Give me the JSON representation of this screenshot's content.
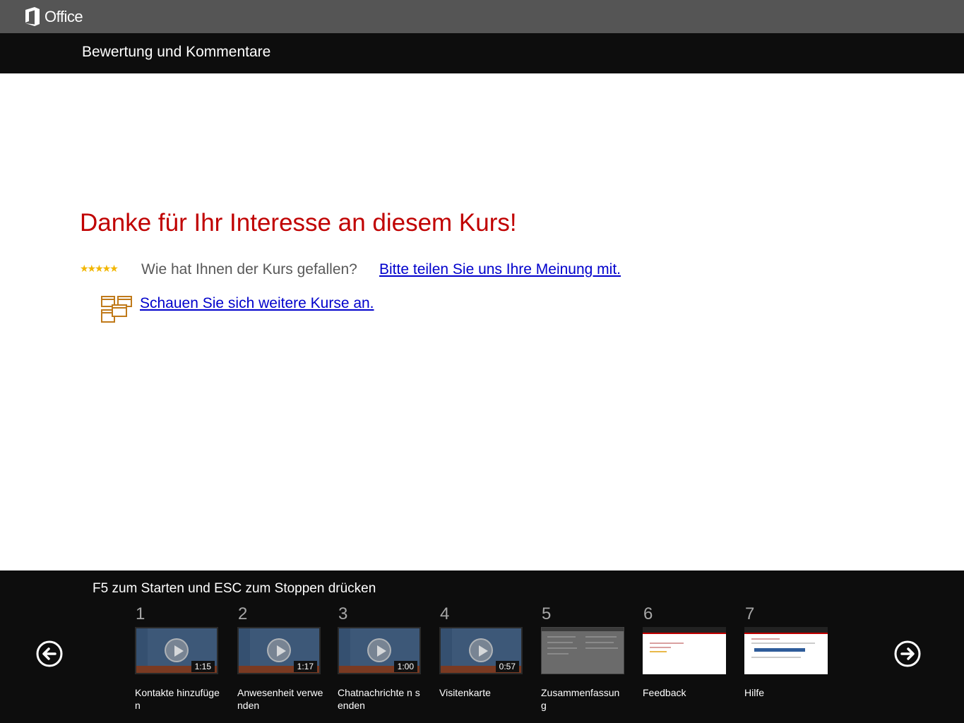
{
  "header": {
    "brand": "Office",
    "title": "Bewertung und Kommentare"
  },
  "main": {
    "heading": "Danke für Ihr Interesse  an diesem  Kurs!",
    "stars": "★★★★★",
    "rating_question": "Wie hat Ihnen der Kurs gefallen?",
    "rating_link": "Bitte teilen Sie uns Ihre Meinung mit.",
    "courses_link": "Schauen Sie sich weitere Kurse an."
  },
  "footer": {
    "hint": "F5 zum Starten und ESC zum Stoppen drücken",
    "slides": [
      {
        "num": "1",
        "label": "Kontakte hinzufügen",
        "duration": "1:15"
      },
      {
        "num": "2",
        "label": "Anwesenheit verwenden",
        "duration": "1:17"
      },
      {
        "num": "3",
        "label": "Chatnachrichte n senden",
        "duration": "1:00"
      },
      {
        "num": "4",
        "label": "Visitenkarte",
        "duration": "0:57"
      },
      {
        "num": "5",
        "label": "Zusammenfassun g"
      },
      {
        "num": "6",
        "label": "Feedback"
      },
      {
        "num": "7",
        "label": "Hilfe"
      }
    ]
  },
  "icons": {
    "office_logo": "office-logo-icon",
    "prev": "arrow-left-circle-icon",
    "next": "arrow-right-circle-icon",
    "courses": "windows-stack-icon",
    "play": "play-icon"
  },
  "colors": {
    "heading": "#c00000",
    "link": "#0000cc",
    "stars": "#f2b600",
    "icon_accent": "#c07a1a"
  }
}
